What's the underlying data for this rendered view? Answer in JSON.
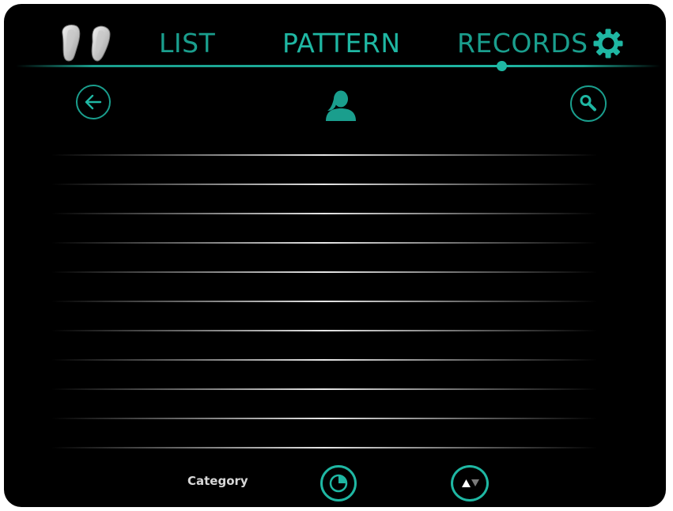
{
  "nav": {
    "tabs": [
      {
        "label": "LIST"
      },
      {
        "label": "PATTERN"
      },
      {
        "label": "RECORDS"
      }
    ],
    "active_tab": "PATTERN"
  },
  "icons": {
    "logo": "footprints-logo-icon",
    "settings": "gear-icon",
    "back": "arrow-left-icon",
    "user": "person-icon",
    "search": "search-icon",
    "chart": "pie-chart-icon",
    "sort": "sort-up-down-icon"
  },
  "list": {
    "row_count": 11
  },
  "bottom_bar": {
    "category_label": "Category"
  },
  "colors": {
    "accent": "#1fb7a3",
    "accent_dim": "#1a9e8d",
    "background": "#000000",
    "row_divider": "#e6e6e6"
  }
}
